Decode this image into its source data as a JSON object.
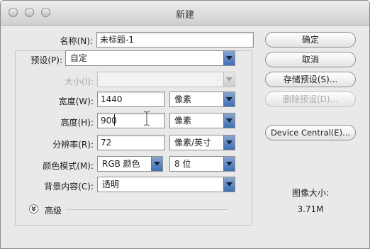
{
  "window": {
    "title": "新建"
  },
  "form": {
    "name_label": "名称(N):",
    "name_value": "未标题-1",
    "preset_label": "预设(P):",
    "preset_value": "自定",
    "size_label": "大小(I):",
    "size_value": "",
    "width_label": "宽度(W):",
    "width_value": "1440",
    "width_unit": "像素",
    "height_label": "高度(H):",
    "height_value": "900",
    "height_unit": "像素",
    "resolution_label": "分辨率(R):",
    "resolution_value": "72",
    "resolution_unit": "像素/英寸",
    "color_mode_label": "颜色模式(M):",
    "color_mode_value": "RGB 颜色",
    "bit_depth_value": "8 位",
    "background_label": "背景内容(C):",
    "background_value": "透明",
    "advanced_label": "高级"
  },
  "buttons": {
    "ok": "确定",
    "cancel": "取消",
    "save_preset": "存储预设(S)...",
    "delete_preset": "删除预设(D)...",
    "device_central": "Device Central(E)..."
  },
  "info": {
    "image_size_label": "图像大小:",
    "image_size_value": "3.71M"
  },
  "colors": {
    "accent": "#3d6fb5",
    "window_bg": "#e9e9e9"
  }
}
